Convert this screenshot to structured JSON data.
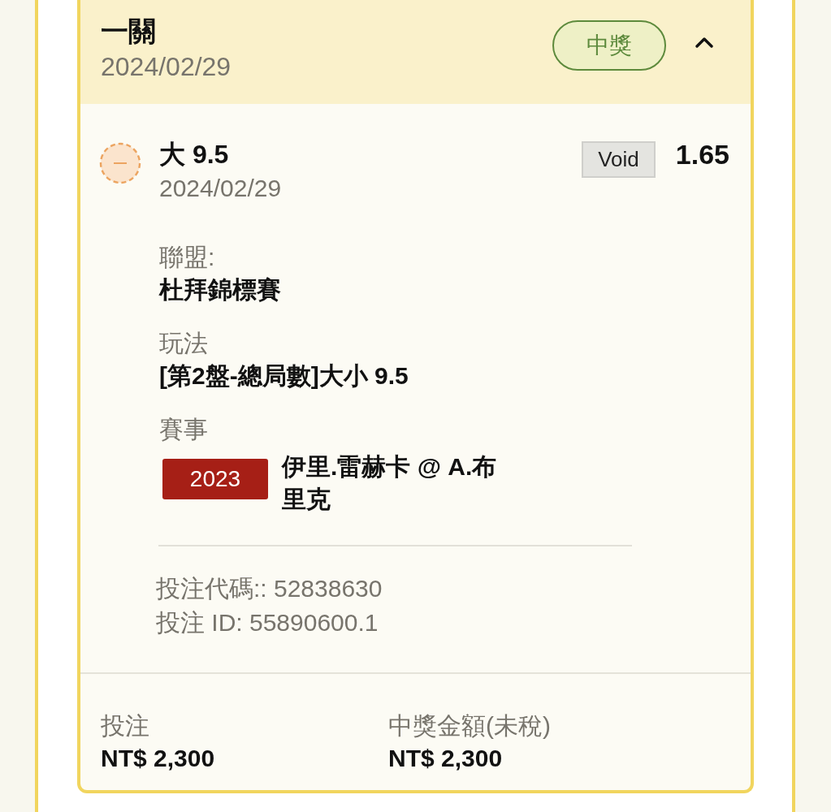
{
  "ticket": {
    "title": "一關",
    "date": "2024/02/29",
    "badge": "中獎",
    "expanded": true
  },
  "selections": [
    {
      "kind": "void",
      "pick": "大 9.5",
      "date": "2024/02/29",
      "status_label": "Void",
      "odds": "1.65",
      "details": [
        {
          "label": "聯盟:",
          "value": "杜拜錦標賽"
        },
        {
          "label": "玩法",
          "value": "[第2盤-總局數]大小 9.5"
        }
      ],
      "event": {
        "label": "賽事",
        "tag": "2023",
        "teams": "伊里.雷赫卡 @ A.布里克"
      }
    }
  ],
  "codes": [
    "投注代碼:: 52838630",
    "投注 ID: 55890600.1"
  ],
  "totals": [
    {
      "label": "投注",
      "amount": "NT$ 2,300"
    },
    {
      "label": "中獎金額(未稅)",
      "amount": "NT$ 2,300"
    }
  ]
}
